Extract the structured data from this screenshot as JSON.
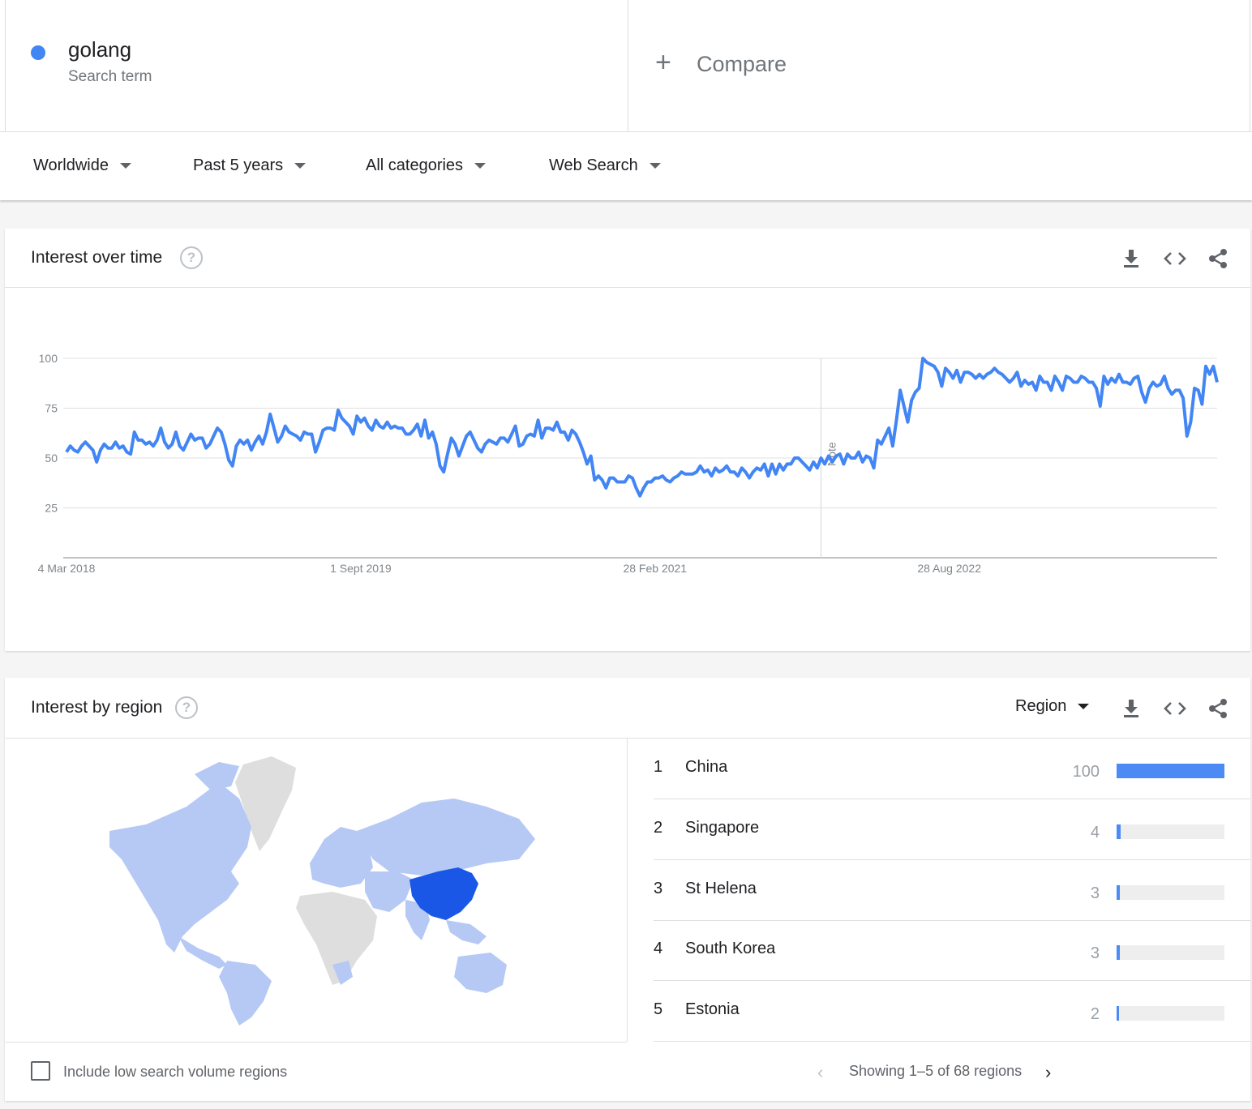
{
  "term": {
    "name": "golang",
    "subtitle": "Search term",
    "color": "#4285f4"
  },
  "compare": {
    "label": "Compare"
  },
  "filters": [
    "Worldwide",
    "Past 5 years",
    "All categories",
    "Web Search"
  ],
  "interest_over_time": {
    "title": "Interest over time",
    "note_label": "Note",
    "chart_data": {
      "type": "line",
      "title": "",
      "xlabel": "",
      "ylabel": "",
      "yticks": [
        100,
        75,
        50,
        25
      ],
      "ylim": [
        0,
        100
      ],
      "x_tick_labels": [
        "4 Mar 2018",
        "1 Sept 2019",
        "28 Feb 2021",
        "28 Aug 2022"
      ],
      "x_tick_index": [
        0,
        78,
        156,
        234
      ],
      "note_index": 200,
      "grid": true,
      "color": "#4285f4",
      "series": [
        {
          "values": [
            53,
            56,
            54,
            53,
            56,
            58,
            56,
            54,
            48,
            54,
            57,
            55,
            55,
            58,
            55,
            56,
            53,
            52,
            63,
            59,
            59,
            57,
            58,
            56,
            59,
            65,
            58,
            55,
            57,
            63,
            56,
            54,
            58,
            62,
            59,
            60,
            60,
            55,
            57,
            61,
            65,
            63,
            57,
            49,
            46,
            56,
            59,
            57,
            59,
            54,
            58,
            61,
            57,
            63,
            72,
            65,
            58,
            61,
            66,
            63,
            62,
            61,
            59,
            63,
            62,
            62,
            53,
            58,
            64,
            65,
            65,
            64,
            74,
            70,
            68,
            66,
            62,
            71,
            68,
            70,
            66,
            64,
            69,
            66,
            65,
            68,
            65,
            66,
            65,
            65,
            62,
            62,
            64,
            67,
            61,
            69,
            60,
            63,
            57,
            46,
            43,
            52,
            60,
            57,
            51,
            56,
            61,
            63,
            59,
            55,
            53,
            57,
            59,
            58,
            57,
            60,
            60,
            58,
            62,
            66,
            56,
            57,
            61,
            62,
            61,
            69,
            60,
            65,
            65,
            64,
            68,
            63,
            63,
            59,
            64,
            62,
            58,
            53,
            47,
            51,
            39,
            41,
            39,
            35,
            40,
            40,
            38,
            38,
            38,
            41,
            40,
            35,
            31,
            35,
            38,
            38,
            40,
            40,
            41,
            39,
            38,
            40,
            41,
            43,
            42,
            42,
            42,
            43,
            46,
            43,
            44,
            41,
            45,
            43,
            44,
            46,
            43,
            43,
            41,
            45,
            43,
            40,
            43,
            45,
            44,
            47,
            41,
            47,
            42,
            47,
            44,
            47,
            47,
            50,
            50,
            48,
            46,
            44,
            48,
            45,
            50,
            47,
            51,
            48,
            51,
            52,
            47,
            52,
            50,
            50,
            53,
            48,
            51,
            50,
            45,
            59,
            57,
            61,
            65,
            56,
            69,
            84,
            76,
            68,
            79,
            83,
            85,
            100,
            98,
            97,
            96,
            93,
            86,
            95,
            93,
            90,
            94,
            88,
            93,
            93,
            92,
            90,
            92,
            90,
            92,
            93,
            95,
            93,
            92,
            90,
            88,
            90,
            93,
            86,
            89,
            87,
            88,
            84,
            91,
            88,
            88,
            84,
            91,
            88,
            84,
            91,
            90,
            88,
            88,
            91,
            90,
            88,
            88,
            85,
            76,
            91,
            87,
            90,
            88,
            92,
            88,
            88,
            87,
            90,
            91,
            83,
            78,
            85,
            88,
            86,
            87,
            91,
            85,
            82,
            84,
            84,
            80,
            61,
            68,
            85,
            84,
            77,
            96,
            92,
            96,
            88
          ]
        }
      ]
    }
  },
  "interest_by_region": {
    "title": "Interest by region",
    "selector": "Region",
    "regions": [
      {
        "rank": "1",
        "name": "China",
        "value": "100",
        "pct": 100
      },
      {
        "rank": "2",
        "name": "Singapore",
        "value": "4",
        "pct": 4
      },
      {
        "rank": "3",
        "name": "St Helena",
        "value": "3",
        "pct": 3
      },
      {
        "rank": "4",
        "name": "South Korea",
        "value": "3",
        "pct": 3
      },
      {
        "rank": "5",
        "name": "Estonia",
        "value": "2",
        "pct": 2
      }
    ],
    "include_low_volume": "Include low search volume regions",
    "pager": "Showing 1–5 of 68 regions",
    "map_colors": {
      "highlight": "#1a57e6",
      "light": "#b6c9f5",
      "none": "#dedede"
    }
  }
}
